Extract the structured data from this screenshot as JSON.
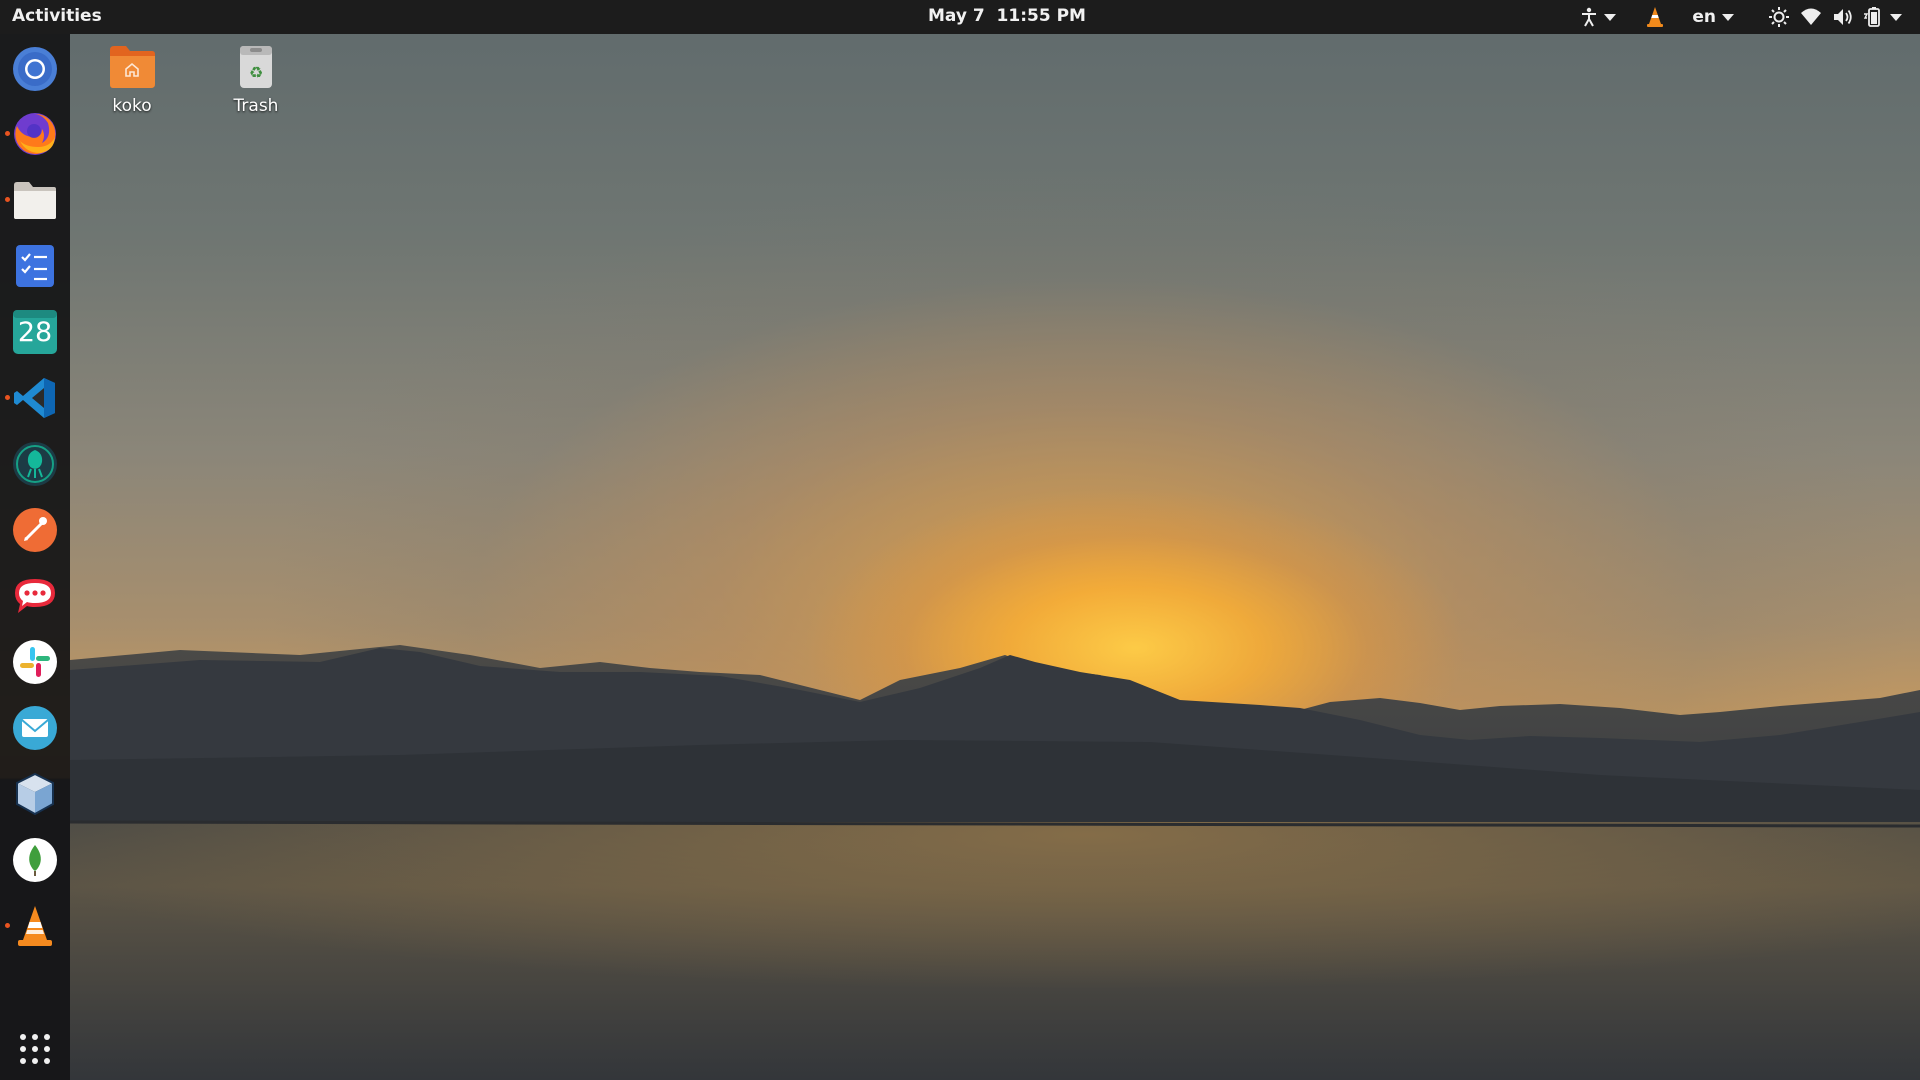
{
  "topbar": {
    "activities_label": "Activities",
    "clock": "May 7  11:55 PM",
    "language": "en",
    "tray_icons": [
      "accessibility-icon",
      "vlc-tray-icon",
      "brightness-icon",
      "wifi-icon",
      "volume-icon",
      "battery-icon"
    ]
  },
  "dock": {
    "items": [
      {
        "name": "chromium",
        "icon": "chromium-icon",
        "running": false
      },
      {
        "name": "firefox",
        "icon": "firefox-icon",
        "running": true
      },
      {
        "name": "files",
        "icon": "files-icon",
        "running": true
      },
      {
        "name": "tasks",
        "icon": "tasks-icon",
        "running": false
      },
      {
        "name": "calendar",
        "icon": "calendar-icon",
        "running": false,
        "text": "28"
      },
      {
        "name": "vscode",
        "icon": "vscode-icon",
        "running": true
      },
      {
        "name": "gitkraken",
        "icon": "gitkraken-icon",
        "running": false
      },
      {
        "name": "postman",
        "icon": "postman-icon",
        "running": false
      },
      {
        "name": "rocketchat",
        "icon": "rocketchat-icon",
        "running": false
      },
      {
        "name": "slack",
        "icon": "slack-icon",
        "running": false
      },
      {
        "name": "mail",
        "icon": "mail-icon",
        "running": false
      },
      {
        "name": "virtualbox",
        "icon": "virtualbox-icon",
        "running": false
      },
      {
        "name": "mongodb-compass",
        "icon": "mongodb-icon",
        "running": false
      },
      {
        "name": "vlc",
        "icon": "vlc-icon",
        "running": true
      }
    ],
    "show_apps_icon": "app-grid-icon"
  },
  "desktop": {
    "icons": [
      {
        "label": "koko",
        "icon": "home-folder-icon"
      },
      {
        "label": "Trash",
        "icon": "trash-icon"
      }
    ]
  },
  "colors": {
    "topbar_bg": "#1c1c1c",
    "dock_bg": "#141416",
    "running_indicator": "#e95420"
  }
}
